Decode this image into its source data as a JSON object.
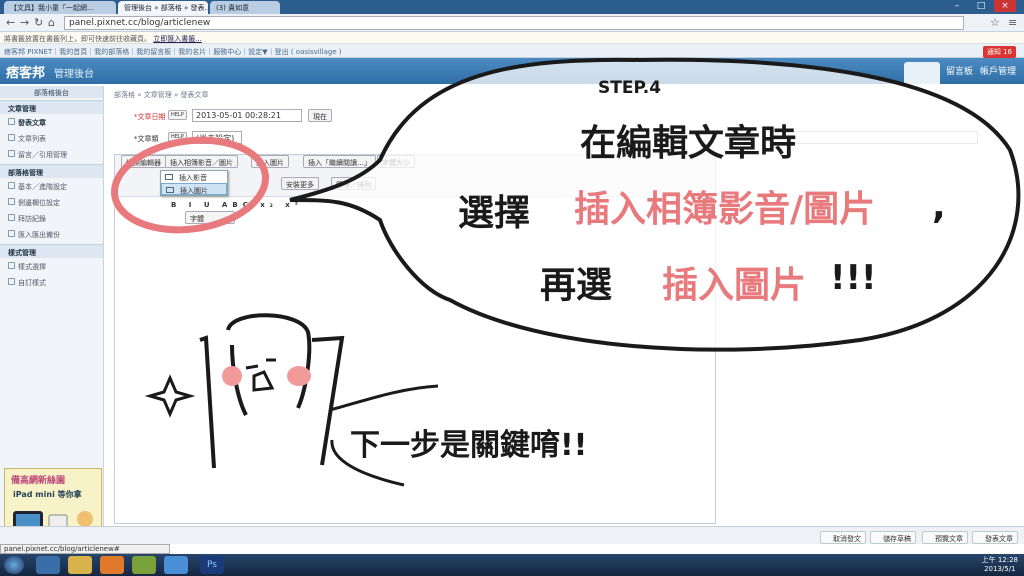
{
  "browser": {
    "tabs": [
      "【文具】我小童「一起網…",
      "管理後台 » 部落格 » 發表…",
      "(3) 貴如意"
    ],
    "url": "panel.pixnet.cc/blog/articlenew",
    "bookmark_bar_text": "將書籤放置在書籤列上，即可快速前往收藏頁。",
    "bookmark_link": "立即匯入書籤..."
  },
  "topnav": {
    "text": "痞客邦 PIXNET｜我的首頁｜我的部落格｜我的留言板｜我的名片｜服務中心｜設定▼｜登出 ( oasisvillage )",
    "notice": "通知 16"
  },
  "header": {
    "logo": "痞客邦",
    "title": "管理後台",
    "nav": [
      "留言板",
      "帳戶管理"
    ]
  },
  "sidebar": {
    "head": "部落格後台",
    "sections": [
      {
        "title": "文章管理",
        "items": [
          "發表文章",
          "文章列表",
          "留言／引用管理"
        ]
      },
      {
        "title": "部落格管理",
        "items": [
          "基本／進階設定",
          "側邊欄位設定",
          "拜訪紀錄",
          "匯入匯出備份"
        ]
      },
      {
        "title": "樣式管理",
        "items": [
          "樣式選擇",
          "自訂樣式"
        ]
      }
    ],
    "ad": {
      "line1": "備高網新絲園",
      "line2": "iPad mini 等你拿"
    }
  },
  "main": {
    "breadcrumb": "部落格 » 文章管理 » 發表文章",
    "date_label": "*文章日期",
    "help": "HELP",
    "date_value": "2013-05-01 00:28:21",
    "now_button": "現在",
    "type_label": "*文章類",
    "type_value": "(尚未設定)",
    "toolbar": {
      "editor_btn": "切換編輯器",
      "insert_media": "插入相簿影音／圖片",
      "insert_image": "插入圖片",
      "insert_more": "插入「繼續閱讀…」",
      "font_size": "字體大小",
      "install_more": "安裝更多",
      "sort": "管理／排列",
      "font": "字體"
    },
    "menu": [
      "插入影音",
      "插入圖片"
    ]
  },
  "actions": [
    "取消發文",
    "儲存草稿",
    "預覽文章",
    "發表文章"
  ],
  "status": "panel.pixnet.cc/blog/articlenew#",
  "clock": {
    "time": "上午 12:28",
    "date": "2013/5/1"
  },
  "annotation": {
    "step": "STEP.4",
    "line1": "在編輯文章時",
    "line2a": "選擇",
    "line2b": "插入相簿影音/圖片",
    "line2c": ",",
    "line3a": "再選",
    "line3b": "插入圖片",
    "line3c": "!!!",
    "caption": "下一步是關鍵唷!!"
  },
  "colors": {
    "pink": "#e8797c",
    "ink": "#1a1a1a",
    "header": "#2f6ea6"
  }
}
